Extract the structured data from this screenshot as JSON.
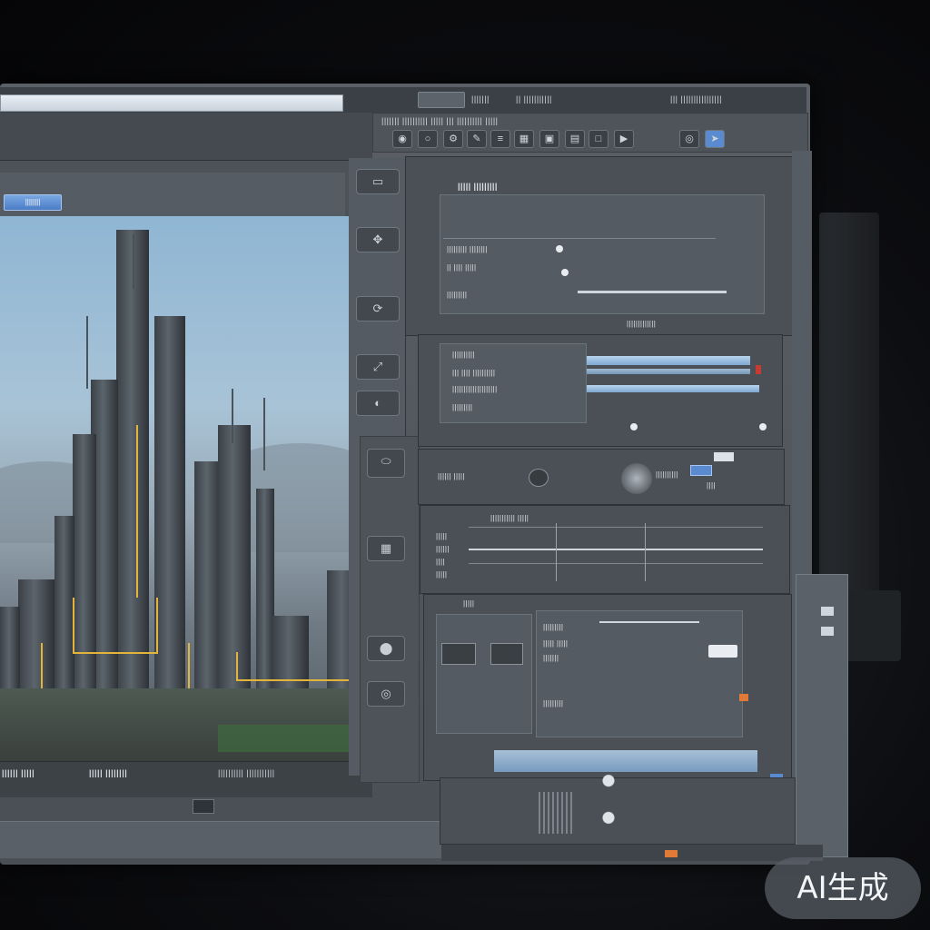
{
  "window": {
    "title_field": "",
    "top_labels": [
      "|||||||",
      "|| |||||||||||",
      "||| ||||||||||||||||"
    ]
  },
  "toolbar": {
    "label_row": "||||||| |||||||||| ||||| ||| |||||||||| |||||",
    "icons": [
      "camera-icon",
      "circle-icon",
      "gear-icon",
      "brush-icon",
      "layers-icon",
      "grid-icon",
      "image-icon",
      "folder-icon",
      "box-icon",
      "render-icon",
      "settings-icon",
      "arrow-icon"
    ]
  },
  "left_panel": {
    "header_label": "||||||||| |||||||||||",
    "button_label": "||||||||",
    "footer_labels": [
      "|||||| |||||",
      "||||| ||||||||",
      "|||||||||| |||||||||||"
    ]
  },
  "properties": {
    "panel1_title": "||||| |||||||||",
    "panel1_rows": [
      "||||||||| ||||||||",
      "|| |||| |||||",
      "|||||||||"
    ],
    "panel1_caption": "|||||||||||||",
    "panel2_rows": [
      "||||||||||",
      "||| |||| ||||||||||",
      "||||||||||||||||||||",
      "|||||||||"
    ],
    "panel3_labels": [
      "|||||| |||||",
      "||||||||||",
      "||||"
    ],
    "panel4_header": "||||||||||| |||||",
    "panel4_rows": [
      "|||||",
      "||||||",
      "||||",
      "|||||"
    ],
    "panel5_header": "|||||",
    "panel5_rows": [
      "|||||||||",
      "||||| |||||",
      "|||||||",
      "|||||||||"
    ]
  },
  "colors": {
    "accent_blue": "#5a8ad0",
    "accent_orange": "#e07a36",
    "highlight_yellow": "#e3b43a",
    "panel_gray": "#4a5056"
  },
  "watermark": "AI生成"
}
